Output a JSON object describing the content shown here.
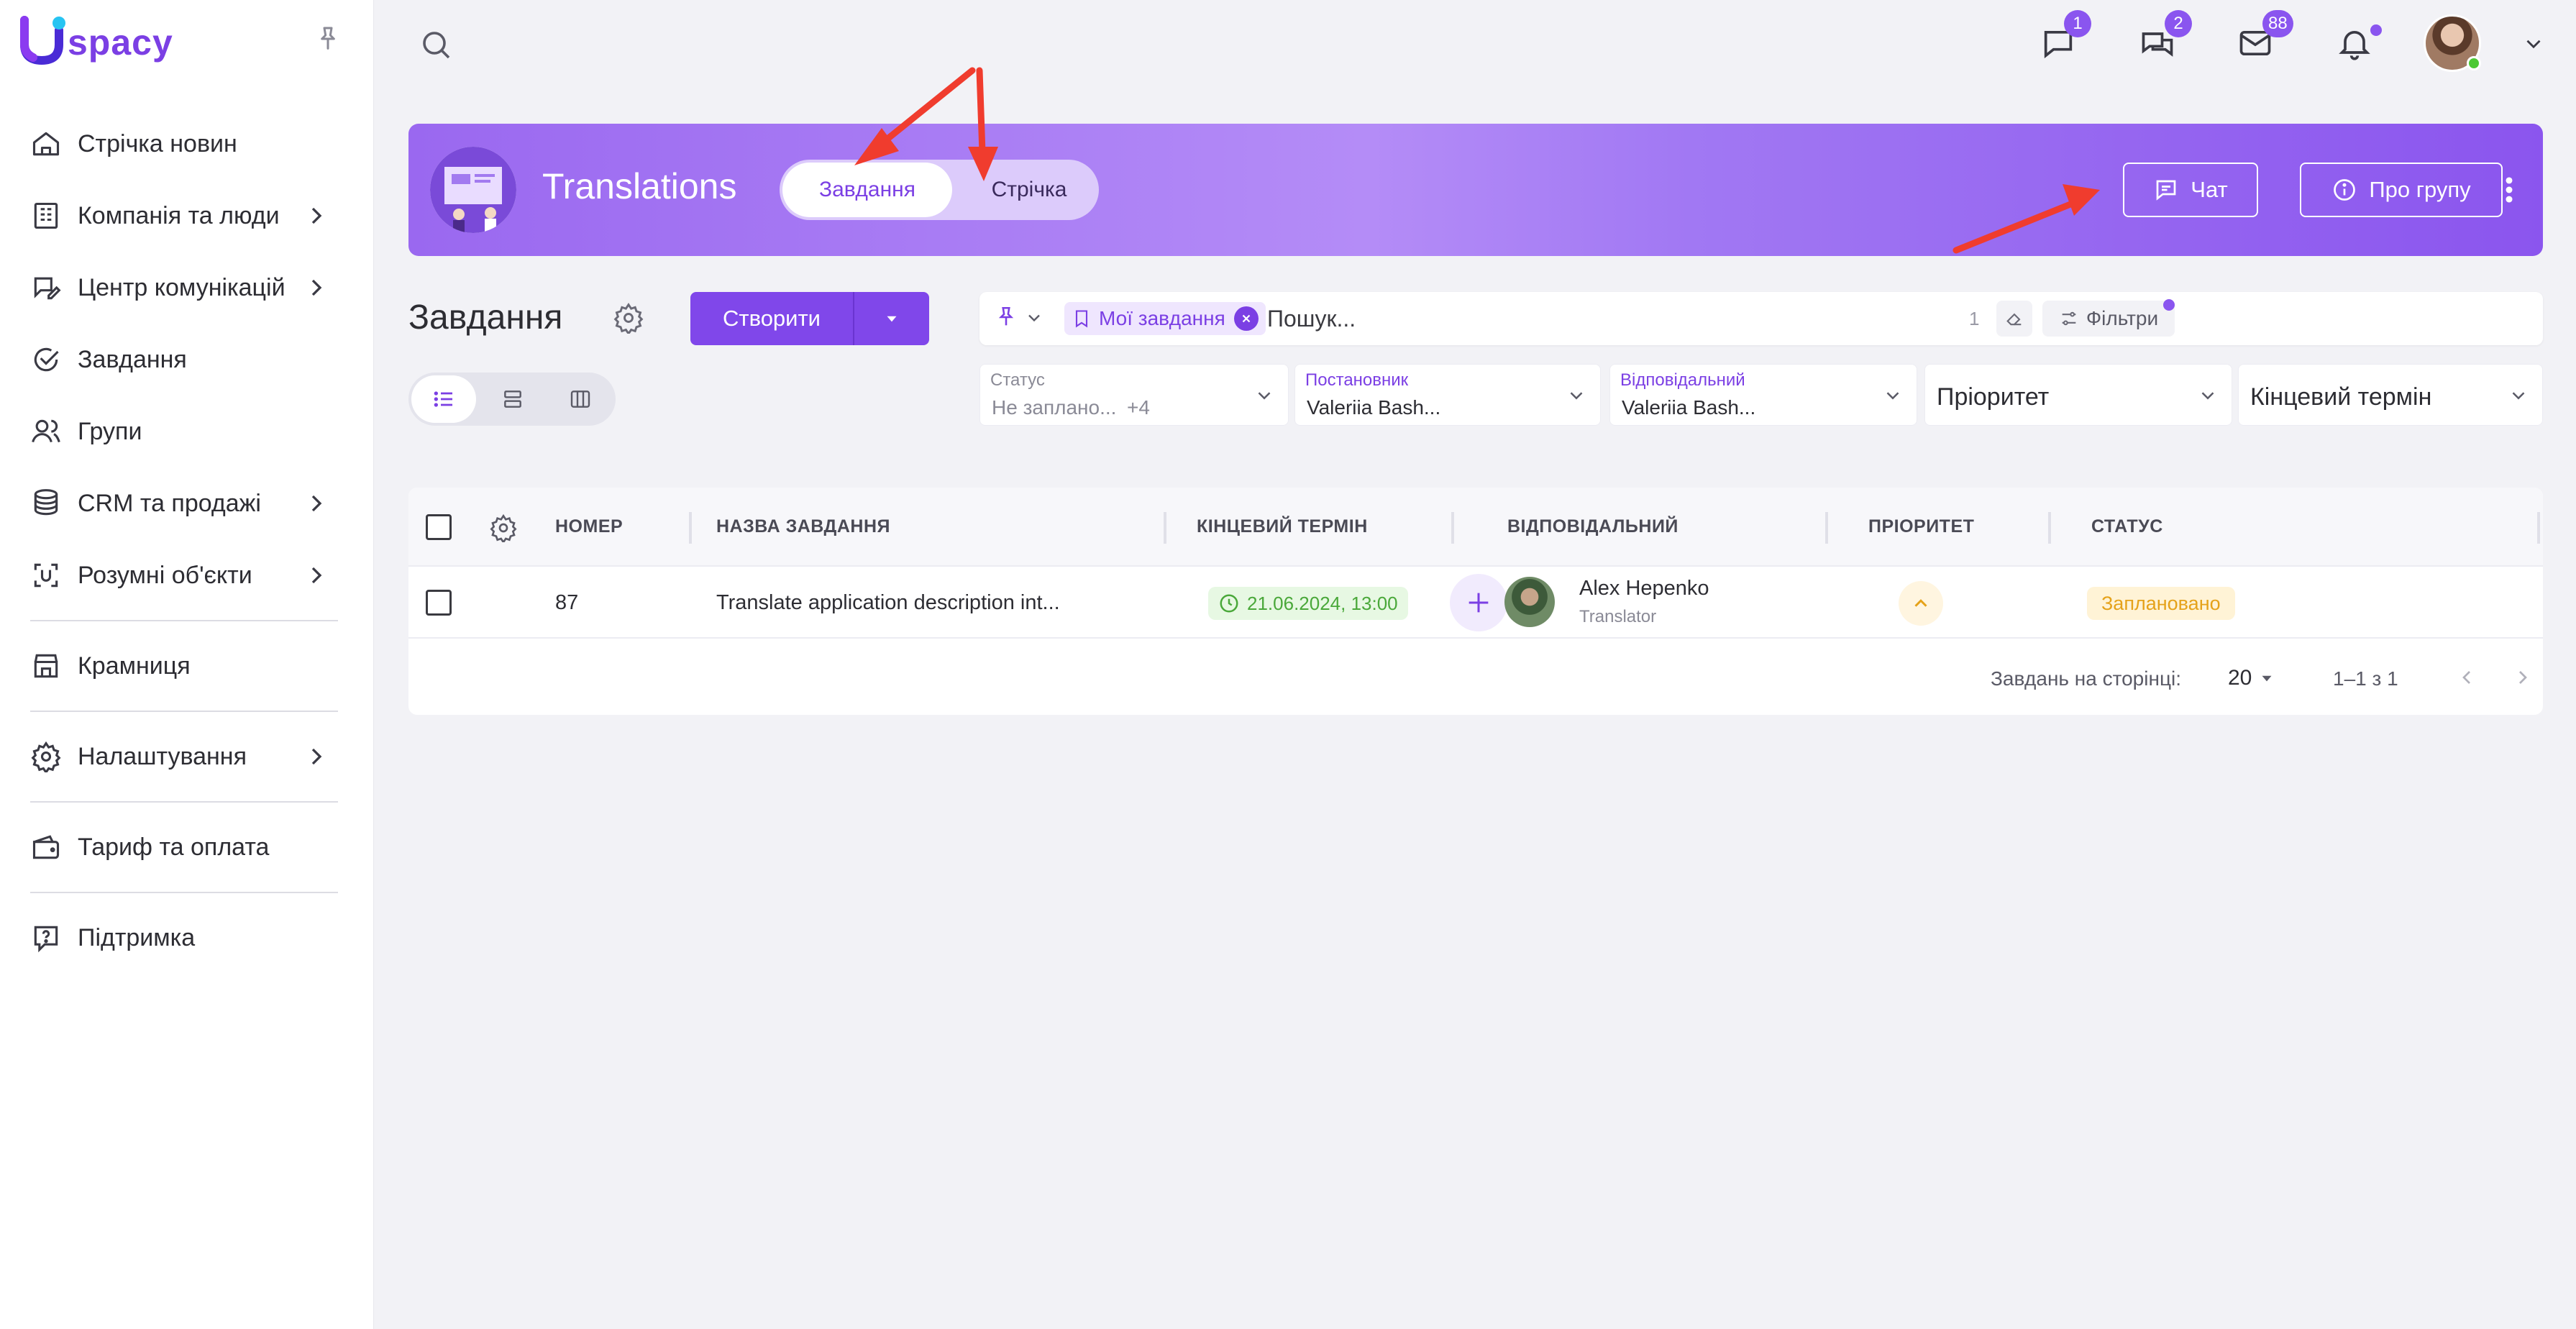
{
  "brand": {
    "logo_text": "spacy",
    "accent": "#7b3fe4"
  },
  "sidebar": {
    "items": [
      {
        "label": "Стрічка новин",
        "icon": "home-icon",
        "has_arrow": false
      },
      {
        "label": "Компанія та люди",
        "icon": "building-icon",
        "has_arrow": true
      },
      {
        "label": "Центр комунікацій",
        "icon": "chat-edit-icon",
        "has_arrow": true
      },
      {
        "label": "Завдання",
        "icon": "check-circle-icon",
        "has_arrow": false
      },
      {
        "label": "Групи",
        "icon": "people-icon",
        "has_arrow": false
      },
      {
        "label": "CRM та продажі",
        "icon": "coins-icon",
        "has_arrow": true
      },
      {
        "label": "Розумні об'єкти",
        "icon": "scan-object-icon",
        "has_arrow": true
      },
      {
        "label": "Крамниця",
        "icon": "store-icon",
        "has_arrow": false
      },
      {
        "label": "Налаштування",
        "icon": "gear-icon",
        "has_arrow": true
      },
      {
        "label": "Тариф та оплата",
        "icon": "wallet-icon",
        "has_arrow": false
      },
      {
        "label": "Підтримка",
        "icon": "help-icon",
        "has_arrow": false
      }
    ]
  },
  "topbar": {
    "badges": {
      "messages": "1",
      "chats": "2",
      "mail": "88"
    }
  },
  "group": {
    "title": "Translations",
    "tab_tasks": "Завдання",
    "tab_feed": "Стрічка",
    "chat_button": "Чат",
    "about_button": "Про групу"
  },
  "tasks": {
    "page_title": "Завдання",
    "create_button": "Створити",
    "search": {
      "chip_label": "Мої завдання",
      "placeholder": "Пошук...",
      "count": "1",
      "filters_label": "Фільтри"
    },
    "filters": {
      "status": {
        "label": "Статус",
        "value": "Не заплано...",
        "extra": "+4"
      },
      "author": {
        "label": "Постановник",
        "value": "Valeriia Bash..."
      },
      "assignee": {
        "label": "Відповідальний",
        "value": "Valeriia Bash..."
      },
      "priority": {
        "label": "Пріоритет"
      },
      "deadline": {
        "label": "Кінцевий термін"
      }
    },
    "table": {
      "headers": {
        "number": "НОМЕР",
        "name": "НАЗВА ЗАВДАННЯ",
        "deadline": "КІНЦЕВИЙ ТЕРМІН",
        "assignee": "ВІДПОВІДАЛЬНИЙ",
        "priority": "ПРІОРИТЕТ",
        "status": "СТАТУС"
      },
      "rows": [
        {
          "number": "87",
          "name": "Translate application description int...",
          "deadline": "21.06.2024, 13:00",
          "assignee_name": "Alex Hepenko",
          "assignee_role": "Translator",
          "status": "Заплановано"
        }
      ],
      "footer": {
        "per_page_label": "Завдань на сторінці:",
        "per_page_value": "20",
        "range": "1–1 з 1"
      }
    }
  }
}
